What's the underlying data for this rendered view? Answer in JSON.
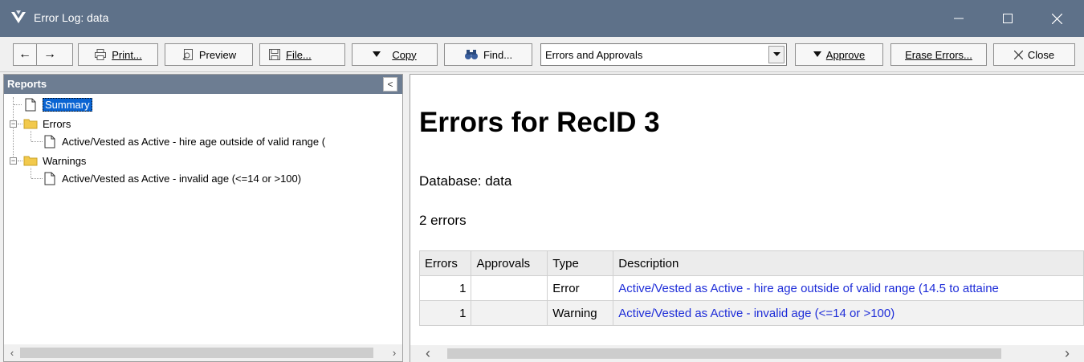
{
  "window": {
    "title": "Error Log: data",
    "minimize_icon": "minimize-icon",
    "maximize_icon": "maximize-icon",
    "close_icon": "close-icon"
  },
  "toolbar": {
    "back_label": "←",
    "forward_label": "→",
    "print_label": "Print...",
    "preview_label": "Preview",
    "file_label": "File...",
    "copy_label": "Copy",
    "find_label": "Find...",
    "report_select": {
      "value": "Errors and Approvals"
    },
    "approve_label": "Approve",
    "erase_label": "Erase Errors...",
    "close_label": "Close"
  },
  "reports_pane": {
    "title": "Reports",
    "collapse_label": "<",
    "tree": {
      "summary": "Summary",
      "errors_folder": "Errors",
      "error_item": "Active/Vested as Active - hire age outside of valid range (",
      "warnings_folder": "Warnings",
      "warning_item": "Active/Vested as Active - invalid age (<=14 or >100)"
    }
  },
  "report": {
    "heading": "Errors for RecID 3",
    "database": "Database: data",
    "count": "2 errors",
    "table": {
      "headers": [
        "Errors",
        "Approvals",
        "Type",
        "Description"
      ],
      "rows": [
        {
          "errors": "1",
          "approvals": "",
          "type": "Error",
          "description": "Active/Vested as Active - hire age outside of valid range (14.5 to attaine"
        },
        {
          "errors": "1",
          "approvals": "",
          "type": "Warning",
          "description": "Active/Vested as Active - invalid age (<=14 or >100)"
        }
      ]
    }
  },
  "colors": {
    "titlebar": "#5e7189",
    "pane_header": "#6d7d92",
    "selection": "#0a64d2",
    "link": "#1e2dd8"
  }
}
